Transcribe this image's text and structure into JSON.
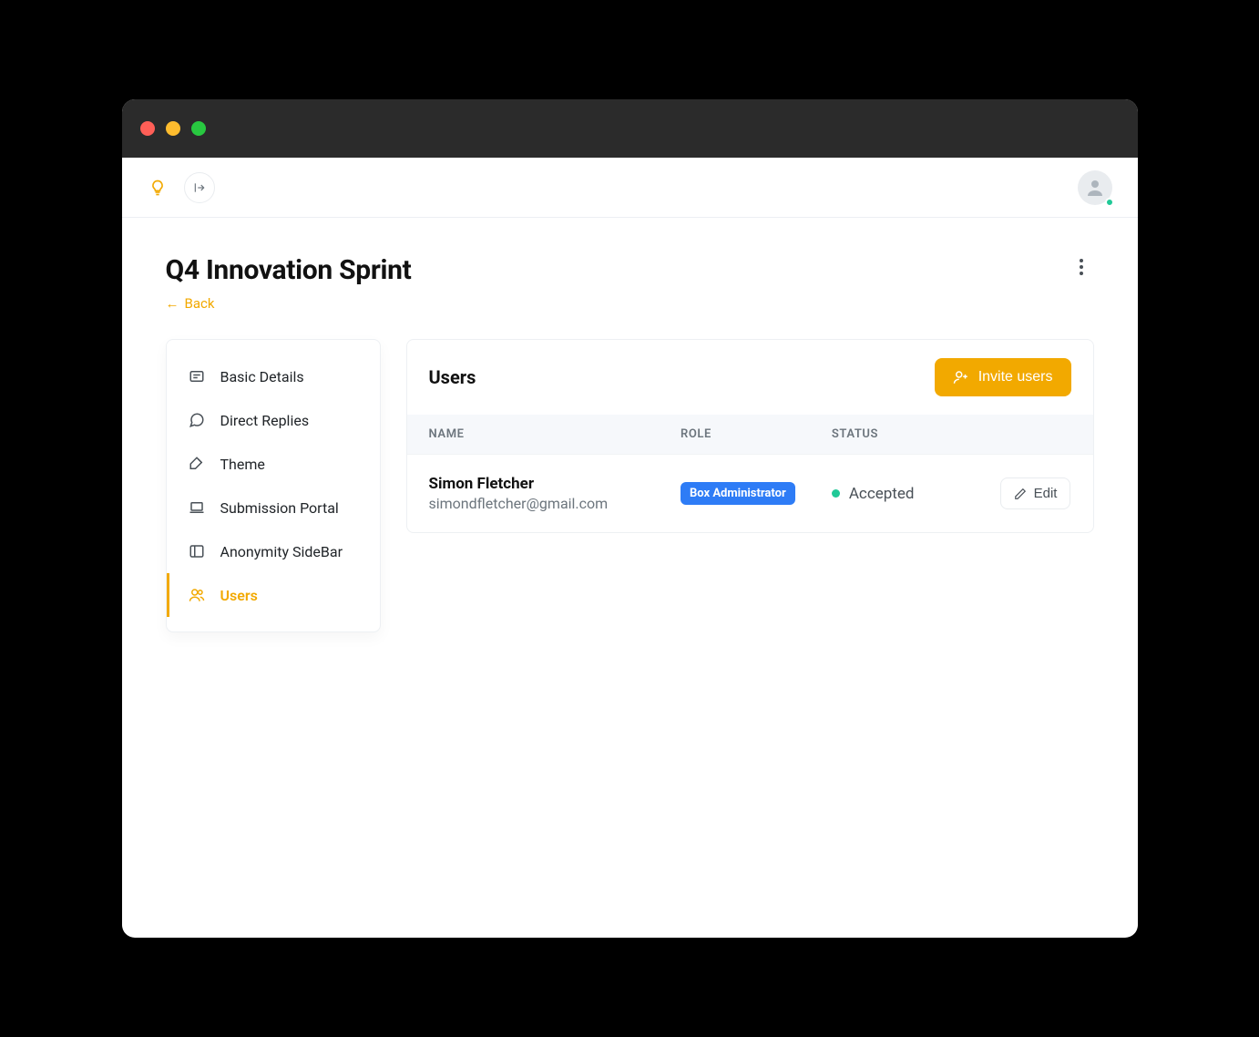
{
  "page": {
    "title": "Q4 Innovation Sprint",
    "back_label": "Back"
  },
  "sidebar": {
    "items": [
      {
        "label": "Basic Details",
        "icon": "card-text-icon",
        "active": false
      },
      {
        "label": "Direct Replies",
        "icon": "chat-icon",
        "active": false
      },
      {
        "label": "Theme",
        "icon": "palette-icon",
        "active": false
      },
      {
        "label": "Submission Portal",
        "icon": "laptop-icon",
        "active": false
      },
      {
        "label": "Anonymity SideBar",
        "icon": "sidebar-icon",
        "active": false
      },
      {
        "label": "Users",
        "icon": "users-icon",
        "active": true
      }
    ]
  },
  "panel": {
    "title": "Users",
    "invite_label": "Invite users",
    "columns": {
      "name": "NAME",
      "role": "ROLE",
      "status": "STATUS"
    }
  },
  "users": [
    {
      "name": "Simon Fletcher",
      "email": "simondfletcher@gmail.com",
      "role": "Box Administrator",
      "status": "Accepted",
      "status_color": "#20c997"
    }
  ],
  "actions": {
    "edit_label": "Edit"
  }
}
